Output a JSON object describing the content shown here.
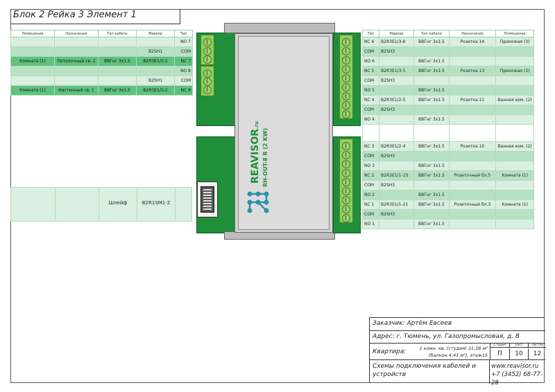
{
  "title": "Блок 2 Рейка 3 Элемент 1",
  "left_table": {
    "headers": [
      "Помещение",
      "Назначение",
      "Тип кабель",
      "Маркер",
      "Тип"
    ],
    "rows": [
      [
        "",
        "",
        "",
        "",
        "NO 7"
      ],
      [
        "",
        "",
        "",
        "B2SH1",
        "COM"
      ],
      [
        "Комната (1)",
        "Потолочный св. 1",
        "ВВГнг 3х1.5",
        "B2R3E1/1-1",
        "NC 7"
      ],
      [
        "",
        "",
        "",
        "",
        "NO 8"
      ],
      [
        "",
        "",
        "",
        "B2SH1",
        "COM"
      ],
      [
        "Комната (1)",
        "Настенный св. 1",
        "ВВГнг 3х1.5",
        "B2R3E1/1-2",
        "NC 8"
      ]
    ],
    "bus_row": [
      "",
      "",
      "Шлейф",
      "B2R1SM1-2",
      ""
    ]
  },
  "right_table": {
    "headers": [
      "Тип",
      "Маркер",
      "Тип кабеля",
      "Назначение",
      "Помещение"
    ],
    "rows": [
      [
        "NC 6",
        "B2R3E1/3-6",
        "ВВГнг 3х1.5",
        "Розетка 14",
        "Прихожая (3)"
      ],
      [
        "COM",
        "B2SH3",
        "",
        "",
        ""
      ],
      [
        "NO 6",
        "",
        "ВВГнг 3х1.5",
        "",
        ""
      ],
      [
        "NC 5",
        "B2R3E1/3-5",
        "ВВГнг 3х1.5",
        "Розетка 13",
        "Прихожая (3)"
      ],
      [
        "COM",
        "B2SH3",
        "",
        "",
        ""
      ],
      [
        "NO 5",
        "",
        "ВВГнг 3х1.5",
        "",
        ""
      ],
      [
        "NC 4",
        "B2R3E1/2-5",
        "ВВГнг 3х1.5",
        "Розетка 11",
        "Ванная ком. (2)"
      ],
      [
        "COM",
        "B2SH3",
        "",
        "",
        ""
      ],
      [
        "NO 4",
        "",
        "ВВГнг 3х1.5",
        "",
        ""
      ],
      [
        "",
        "",
        "",
        "",
        ""
      ],
      [
        "NC 3",
        "B2R3E1/2-4",
        "ВВГнг 3х1.5",
        "Розетка 10",
        "Ванная ком. (2)"
      ],
      [
        "COM",
        "B2SH3",
        "",
        "",
        ""
      ],
      [
        "NO 3",
        "",
        "ВВГнг 3х1.5",
        "",
        ""
      ],
      [
        "NC 2",
        "B2R3E1/1-23",
        "ВВГнг 3х1.5",
        "Розеточный бл.5",
        "Комната (1)"
      ],
      [
        "COM",
        "B2SH3",
        "",
        "",
        ""
      ],
      [
        "NO 2",
        "",
        "ВВГнг 3х1.5",
        "",
        ""
      ],
      [
        "NC 1",
        "B2R3E1/1-21",
        "ВВГнг 3х1.5",
        "Розеточный бл.3",
        "Комната (1)"
      ],
      [
        "COM",
        "B2SH3",
        "",
        "",
        ""
      ],
      [
        "NO 1",
        "",
        "ВВГнг 3х1.5",
        "",
        ""
      ]
    ]
  },
  "device": {
    "brand": "REAVISOR",
    "brand_suffix": ".ru",
    "model": "RH-OUT-8 R (2 KW)"
  },
  "info_block": {
    "customer": "Заказчик: Артём Евсеев",
    "address": "Адрес: г. Тюмень, ул. Газопромысловая, д. 8",
    "apartment_label": "Квартира:",
    "apartment_line1": "1 комн. кв. (студия) 31,58 м²",
    "apartment_line2": "(балкон 4,41 м²), этаж15",
    "stage_label": "Стадия",
    "stage_value": "П",
    "sheet_label": "Лист",
    "sheet_value": "10",
    "sheets_label": "Листов",
    "sheets_value": "12",
    "description": "Схемы подключения кабелей и устройств",
    "website": "www.reavisor.ru",
    "phone": "+7 (3452) 68-77-28"
  }
}
